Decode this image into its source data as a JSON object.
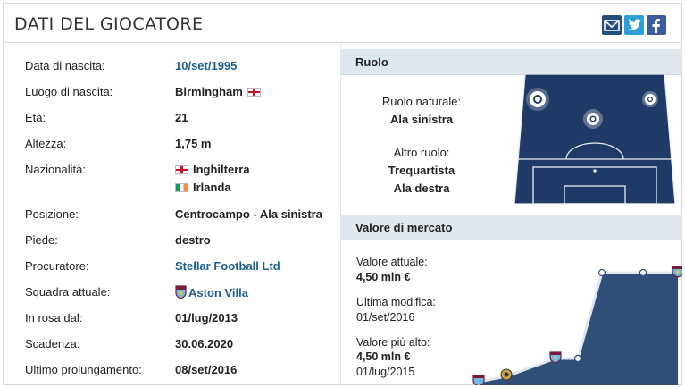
{
  "header": {
    "title": "DATI DEL GIOCATORE",
    "share_icons": [
      "mail-icon",
      "twitter-icon",
      "facebook-icon"
    ]
  },
  "details": [
    {
      "label": "Data di nascita:",
      "value": "10/set/1995",
      "link": true
    },
    {
      "label": "Luogo di nascita:",
      "value": "Birmingham",
      "flag_after": "england"
    },
    {
      "label": "Età:",
      "value": "21"
    },
    {
      "label": "Altezza:",
      "value": "1,75 m"
    },
    {
      "label": "Nazionalità:",
      "value": "Inghilterra",
      "flag": "england",
      "value2": "Irlanda",
      "flag2": "ireland"
    },
    {
      "label": "Posizione:",
      "value": "Centrocampo - Ala sinistra"
    },
    {
      "label": "Piede:",
      "value": "destro"
    },
    {
      "label": "Procuratore:",
      "value": "Stellar Football Ltd",
      "link": true
    },
    {
      "label": "Squadra attuale:",
      "value": "Aston Villa",
      "link": true,
      "crest": true
    },
    {
      "label": "In rosa dal:",
      "value": "01/lug/2013"
    },
    {
      "label": "Scadenza:",
      "value": "30.06.2020"
    },
    {
      "label": "Ultimo prolungamento:",
      "value": "08/set/2016"
    }
  ],
  "role": {
    "heading": "Ruolo",
    "natural_label": "Ruolo naturale:",
    "natural_value": "Ala sinistra",
    "other_label": "Altro ruolo:",
    "other_values": [
      "Trequartista",
      "Ala destra"
    ]
  },
  "market": {
    "heading": "Valore di mercato",
    "current_label": "Valore attuale:",
    "current_value": "4,50 mln €",
    "last_change_label": "Ultima modifica:",
    "last_change_value": "01/set/2016",
    "highest_label": "Valore più alto:",
    "highest_value": "4,50 mln €",
    "highest_date": "01/lug/2015"
  },
  "colors": {
    "link": "#1d5f8f",
    "panel_head": "#dfe7ee",
    "pitch": "#1f3a66",
    "chart_fill": "#2f4f79"
  }
}
